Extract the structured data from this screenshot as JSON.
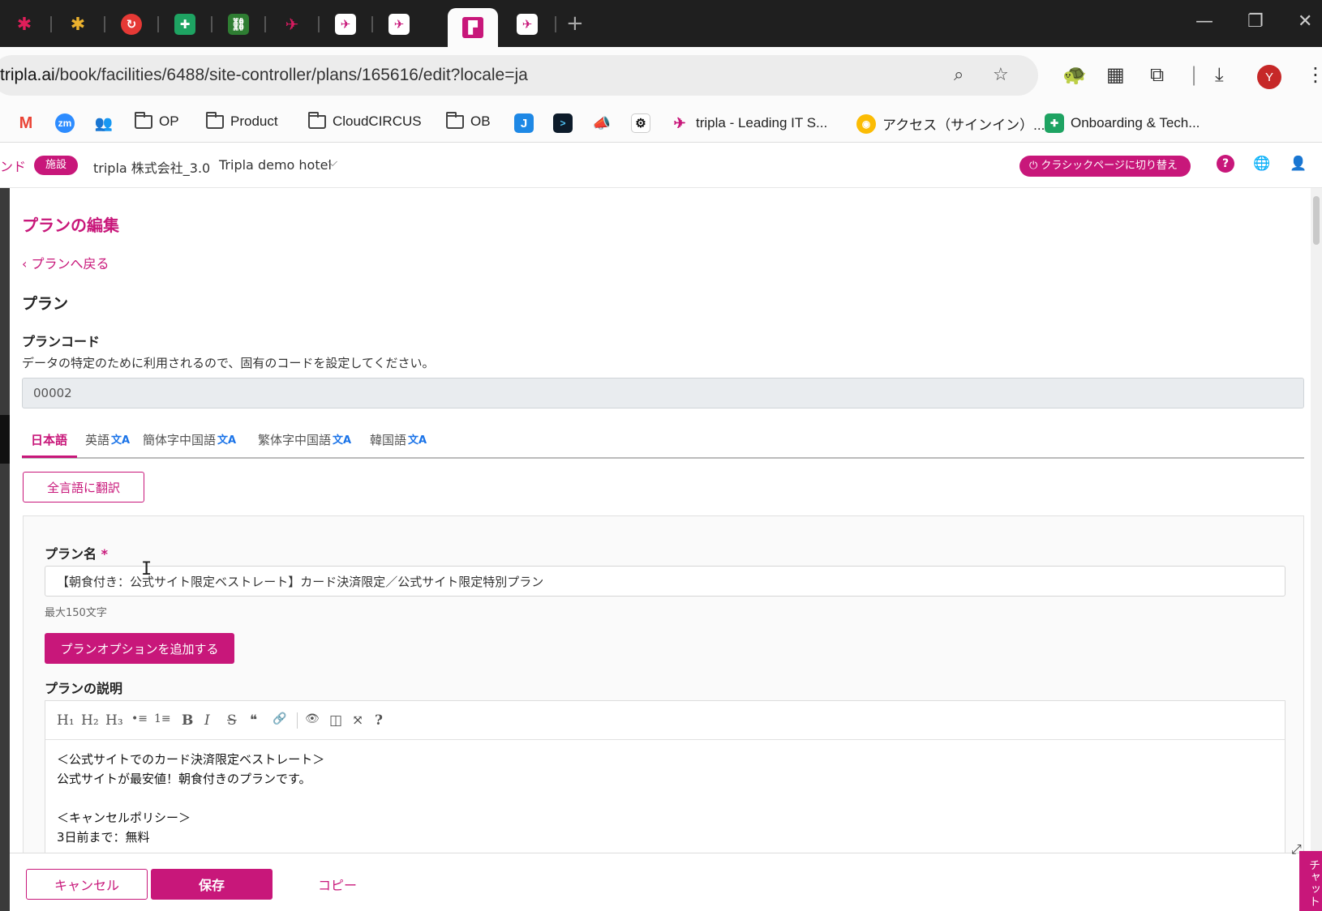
{
  "browser": {
    "url_host": "tripla.ai",
    "url_path": "/book/facilities/6488/site-controller/plans/165616/edit?locale=ja",
    "new_tab_label": "+",
    "avatar_letter": "Y",
    "bookmarks": [
      {
        "label": "",
        "icon": "gmail-icon"
      },
      {
        "label": "zm",
        "icon": "zoom-icon"
      },
      {
        "label": "",
        "icon": "teams-icon"
      },
      {
        "label": "OP",
        "icon": "folder-icon"
      },
      {
        "label": "Product",
        "icon": "folder-icon"
      },
      {
        "label": "CloudCIRCUS",
        "icon": "folder-icon"
      },
      {
        "label": "OB",
        "icon": "folder-icon"
      },
      {
        "label": "J",
        "icon": "jira-icon"
      },
      {
        "label": ">",
        "icon": "terminal-icon"
      },
      {
        "label": "",
        "icon": "megaphone-icon"
      },
      {
        "label": "",
        "icon": "openai-icon"
      },
      {
        "label": "tripla - Leading IT S...",
        "icon": "tripla-icon"
      },
      {
        "label": "アクセス（サインイン）...",
        "icon": "access-icon"
      },
      {
        "label": "Onboarding & Tech...",
        "icon": "sheets-icon"
      }
    ]
  },
  "header": {
    "cut_label": "ンド",
    "badge": "施設",
    "company": "tripla 株式会社_3.0",
    "hotel": "Tripla demo hotel",
    "classic_button": "クラシックページに切り替え",
    "help_icon": "?"
  },
  "page": {
    "title": "プランの編集",
    "back_link": "プランへ戻る",
    "section": "プラン",
    "plan_code_label": "プランコード",
    "plan_code_help": "データの特定のために利用されるので、固有のコードを設定してください。",
    "plan_code_value": "00002",
    "language_tabs": [
      {
        "label": "日本語",
        "translate": ""
      },
      {
        "label": "英語",
        "translate": "文A"
      },
      {
        "label": "簡体字中国語",
        "translate": "文A"
      },
      {
        "label": "繁体字中国語",
        "translate": "文A"
      },
      {
        "label": "韓国語",
        "translate": "文A"
      }
    ],
    "translate_all_button": "全言語に翻訳",
    "plan_name_label": "プラン名",
    "required_mark": "*",
    "plan_name_value": "【朝食付き：公式サイト限定ベストレート】カード決済限定／公式サイト限定特別プラン",
    "plan_name_hint": "最大150文字",
    "add_option_button": "プランオプションを追加する",
    "description_label": "プランの説明",
    "editor_toolbar": [
      "H₁",
      "H₂",
      "H₃",
      "•≡",
      "1≡",
      "B",
      "I",
      "S",
      "❝",
      "🔗",
      "👁",
      "◫",
      "⤧",
      "?"
    ],
    "description_lines": [
      "＜公式サイトでのカード決済限定ベストレート＞",
      "公式サイトが最安値！朝食付きのプランです。",
      "",
      "＜キャンセルポリシー＞",
      "3日前まで：無料"
    ]
  },
  "footer": {
    "cancel": "キャンセル",
    "save": "保存",
    "copy": "コピー",
    "chat": "チャット"
  },
  "colors": {
    "accent": "#c8177a",
    "chrome_dark": "#1f1f1f",
    "translate_blue": "#1a73e8"
  }
}
